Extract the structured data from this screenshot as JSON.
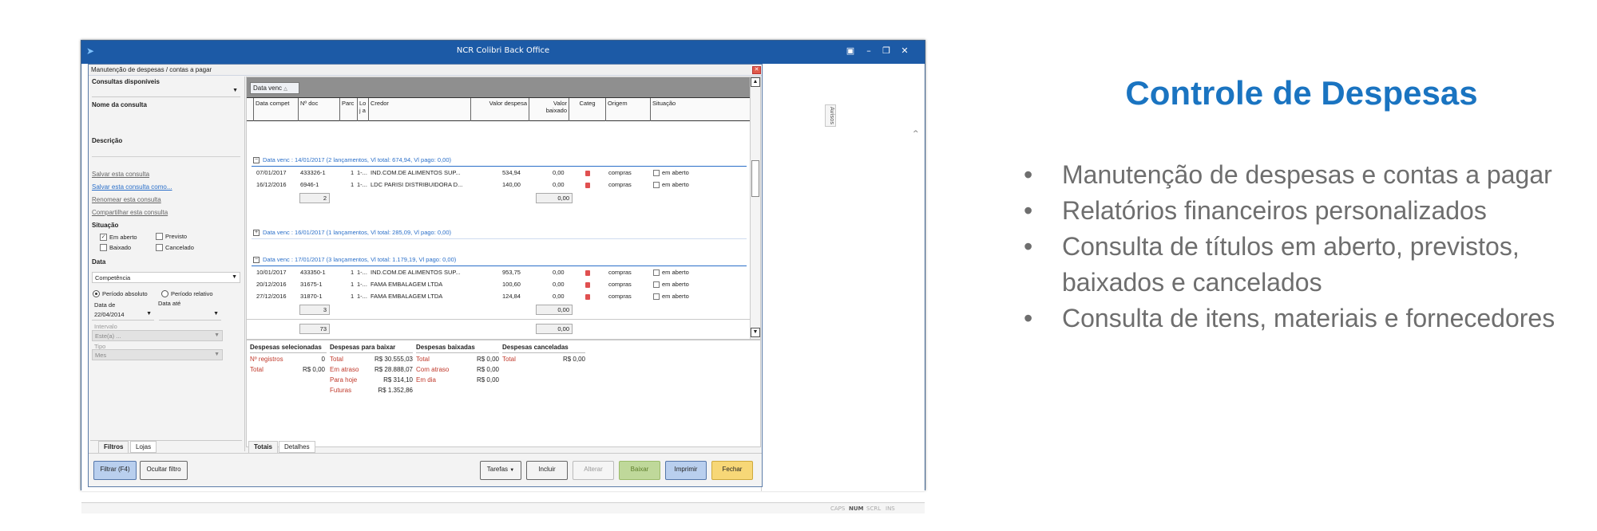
{
  "app": {
    "title": "NCR Colibri Back Office"
  },
  "statusbar": [
    "CAPS",
    "NUM",
    "SCRL",
    "INS"
  ],
  "avisos": "Avisos",
  "dialog": {
    "title": "Manutenção de despesas / contas a pagar",
    "left": {
      "consultas_label": "Consultas disponíveis",
      "nome_label": "Nome da consulta",
      "descricao_label": "Descrição",
      "links": [
        "Salvar esta consulta",
        "Salvar esta consulta como...",
        "Renomear esta consulta",
        "Compartilhar esta consulta"
      ],
      "situacao_label": "Situação",
      "situacao": [
        {
          "label": "Em aberto",
          "checked": true
        },
        {
          "label": "Previsto",
          "checked": false
        },
        {
          "label": "Baixado",
          "checked": false
        },
        {
          "label": "Cancelado",
          "checked": false
        }
      ],
      "data_label": "Data",
      "data_tipo": "Competência",
      "periodo_absoluto": "Período absoluto",
      "periodo_relativo": "Período relativo",
      "data_de_label": "Data de",
      "data_ate_label": "Data até",
      "data_de": "22/04/2014",
      "data_ate": "",
      "intervalo_label": "Intervalo",
      "intervalo_value": "Este(a) ...",
      "tipo_label": "Tipo",
      "tipo_value": "Mes"
    },
    "group_chip": "Data venc",
    "columns": [
      "Data compet",
      "Nº doc",
      "Parc",
      "Loj a",
      "Credor",
      "Valor despesa",
      "Valor baixado",
      "Categ",
      "Origem",
      "Situação"
    ],
    "groups": [
      {
        "header": "Data venc : 14/01/2017 (2 lançamentos, Vl total: 674,94, Vl pago: 0,00)",
        "expanded": true,
        "rows": [
          {
            "data": "07/01/2017",
            "doc": "433326-1",
            "parc": "1",
            "loja": "1-...",
            "credor": "IND.COM.DE ALIMENTOS SUP...",
            "valor": "534,94",
            "baixado": "0,00",
            "origem": "compras",
            "situacao": "em aberto"
          },
          {
            "data": "16/12/2016",
            "doc": "6946-1",
            "parc": "1",
            "loja": "1-...",
            "credor": "LDC PARISI DISTRIBUIDORA D...",
            "valor": "140,00",
            "baixado": "0,00",
            "origem": "compras",
            "situacao": "em aberto"
          }
        ],
        "count": "2",
        "sum_baixado": "0,00"
      },
      {
        "header": "Data venc : 16/01/2017 (1 lançamentos, Vl total: 285,09, Vl pago: 0,00)",
        "expanded": false
      },
      {
        "header": "Data venc : 17/01/2017 (3 lançamentos, Vl total: 1.179,19, Vl pago: 0,00)",
        "expanded": true,
        "rows": [
          {
            "data": "10/01/2017",
            "doc": "433350-1",
            "parc": "1",
            "loja": "1-...",
            "credor": "IND.COM.DE ALIMENTOS SUP...",
            "valor": "953,75",
            "baixado": "0,00",
            "origem": "compras",
            "situacao": "em aberto"
          },
          {
            "data": "20/12/2016",
            "doc": "31675-1",
            "parc": "1",
            "loja": "1-...",
            "credor": "FAMA EMBALAGEM LTDA",
            "valor": "100,60",
            "baixado": "0,00",
            "origem": "compras",
            "situacao": "em aberto"
          },
          {
            "data": "27/12/2016",
            "doc": "31870-1",
            "parc": "1",
            "loja": "1-...",
            "credor": "FAMA EMBALAGEM LTDA",
            "valor": "124,84",
            "baixado": "0,00",
            "origem": "compras",
            "situacao": "em aberto"
          }
        ],
        "count": "3",
        "sum_baixado": "0,00"
      }
    ],
    "grand_count": "73",
    "grand_baixado": "0,00",
    "totals": {
      "selecionadas": {
        "title": "Despesas selecionadas",
        "rows": [
          {
            "label": "Nº registros",
            "value": "0"
          },
          {
            "label": "Total",
            "value": "R$ 0,00"
          }
        ]
      },
      "para_baixar": {
        "title": "Despesas para baixar",
        "rows": [
          {
            "label": "Total",
            "value": "R$ 30.555,03"
          },
          {
            "label": "Em atraso",
            "value": "R$ 28.888,07"
          },
          {
            "label": "Para hoje",
            "value": "R$ 314,10"
          },
          {
            "label": "Futuras",
            "value": "R$ 1.352,86"
          }
        ]
      },
      "baixadas": {
        "title": "Despesas baixadas",
        "rows": [
          {
            "label": "Total",
            "value": "R$ 0,00"
          },
          {
            "label": "Com atraso",
            "value": "R$ 0,00"
          },
          {
            "label": "Em dia",
            "value": "R$ 0,00"
          }
        ]
      },
      "canceladas": {
        "title": "Despesas canceladas",
        "rows": [
          {
            "label": "Total",
            "value": "R$ 0,00"
          }
        ]
      }
    },
    "left_tabs": [
      "Filtros",
      "Lojas"
    ],
    "right_tabs": [
      "Totais",
      "Detalhes"
    ],
    "buttons": {
      "filtrar": "Filtrar (F4)",
      "ocultar": "Ocultar filtro",
      "tarefas": "Tarefas",
      "incluir": "Incluir",
      "alterar": "Alterar",
      "baixar": "Baixar",
      "imprimir": "Imprimir",
      "fechar": "Fechar"
    }
  },
  "slide": {
    "title": "Controle de Despesas",
    "bullets": [
      "Manutenção de despesas e contas a pagar",
      "Relatórios financeiros personalizados",
      "Consulta de títulos em aberto, previstos, baixados e cancelados",
      "Consulta de itens, materiais e fornecedores"
    ]
  }
}
